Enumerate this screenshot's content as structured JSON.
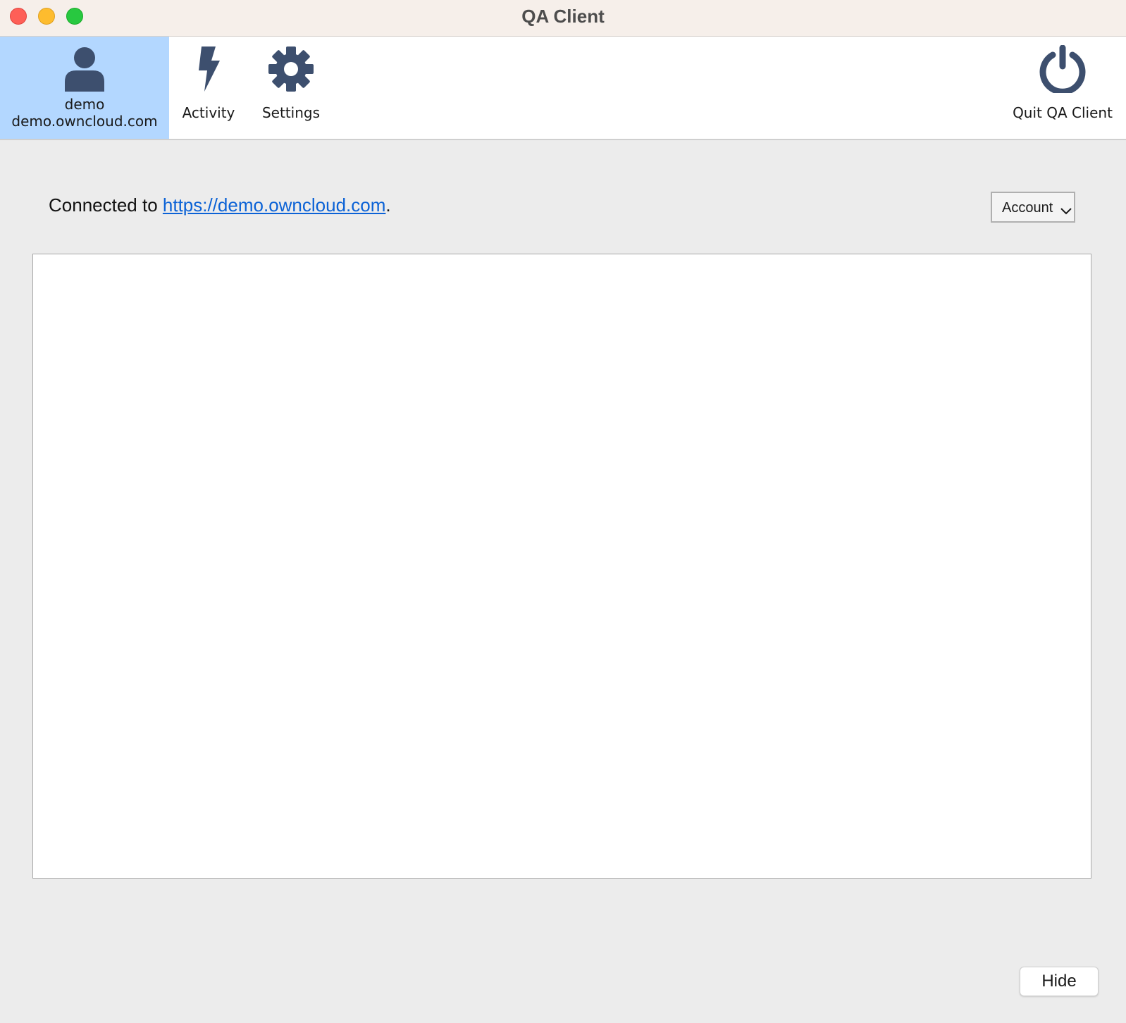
{
  "window": {
    "title": "QA Client"
  },
  "toolbar": {
    "account": {
      "user": "demo",
      "server": "demo.owncloud.com",
      "icon": "user-icon",
      "selected": true
    },
    "activity": {
      "label": "Activity",
      "icon": "lightning-bolt-icon"
    },
    "settings": {
      "label": "Settings",
      "icon": "gear-icon"
    },
    "quit": {
      "label": "Quit QA Client",
      "icon": "power-icon"
    }
  },
  "account_page": {
    "status_prefix": "Connected to ",
    "server_url": "https://demo.owncloud.com",
    "status_suffix": ".",
    "account_menu_label": "Account"
  },
  "footer": {
    "hide_label": "Hide"
  },
  "colors": {
    "icon": "#3d4f6e",
    "selected_tab": "#b3d7ff",
    "link": "#0b62d6"
  }
}
